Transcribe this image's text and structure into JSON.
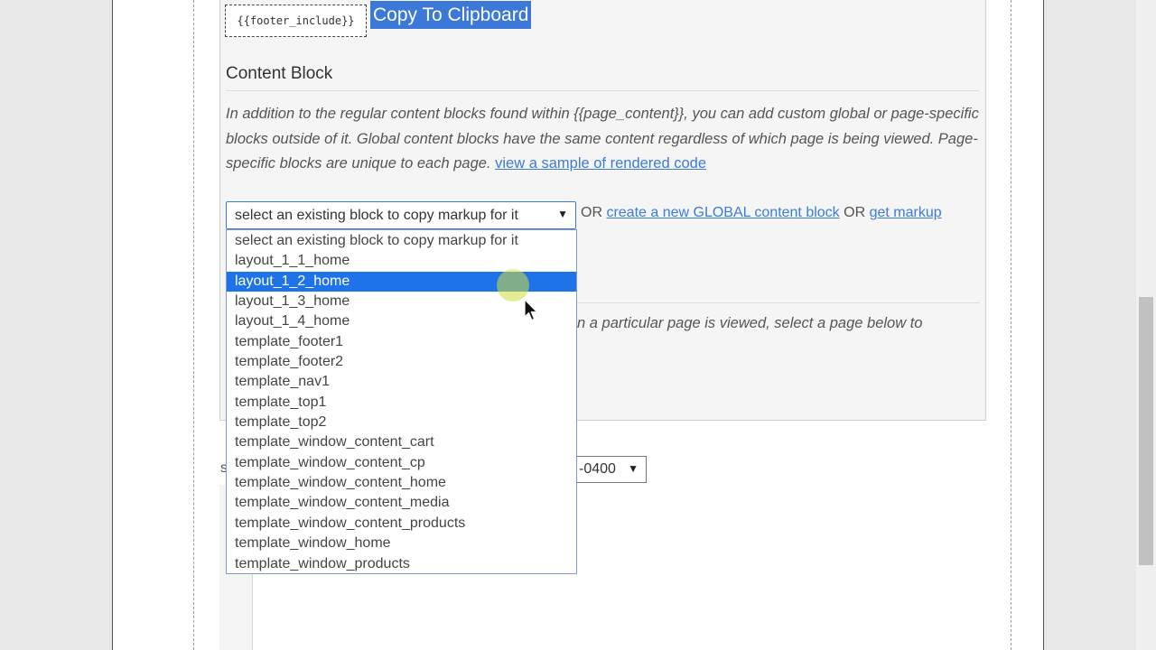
{
  "clipboard": {
    "include_tag": "{{footer_include}}",
    "copy_button": "Copy To Clipboard"
  },
  "content_block": {
    "title": "Content Block",
    "description": "In addition to the regular content blocks found within {{page_content}}, you can add custom global or page-specific blocks outside of it. Global content blocks have the same content regardless of which page is being viewed. Page-specific blocks are unique to each page.",
    "sample_link": "view a sample of rendered code",
    "select_value": "select an existing block to copy markup for it",
    "or1": "OR",
    "create_link": "create a new GLOBAL content block",
    "or2": "OR",
    "markup_link": "get markup"
  },
  "dropdown": {
    "selected_index": 2,
    "options": [
      "select an existing block to copy markup for it",
      "layout_1_1_home",
      "layout_1_2_home",
      "layout_1_3_home",
      "layout_1_4_home",
      "template_footer1",
      "template_footer2",
      "template_nav1",
      "template_top1",
      "template_top2",
      "template_window_content_cart",
      "template_window_content_cp",
      "template_window_content_home",
      "template_window_content_media",
      "template_window_content_products",
      "template_window_home",
      "template_window_products"
    ]
  },
  "page_specific": {
    "description_fragment": "n a particular page is viewed, select a page below to"
  },
  "timezone": {
    "prefix_letter": "s",
    "value": "-0400"
  },
  "icons": {
    "select_arrow": "dropdown-arrow-icon",
    "cursor": "mouse-pointer-icon"
  }
}
